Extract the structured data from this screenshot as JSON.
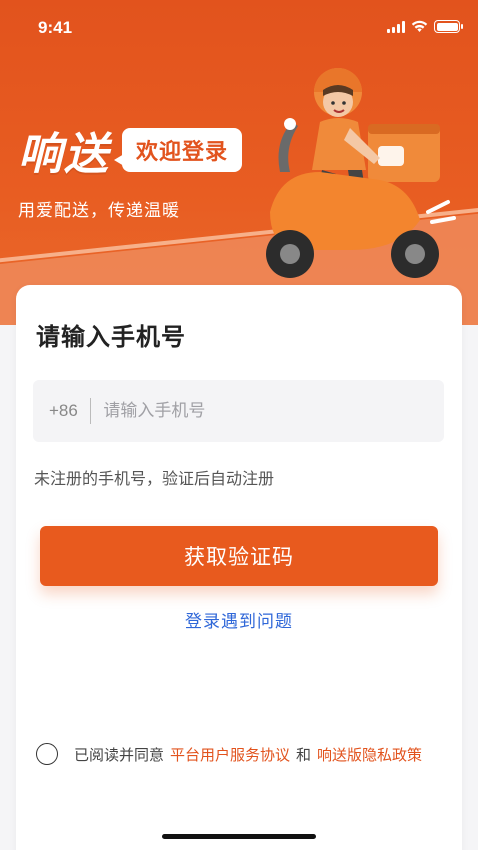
{
  "status_bar": {
    "time": "9:41"
  },
  "hero": {
    "brand_name": "响送",
    "welcome_badge": "欢迎登录",
    "slogan": "用爱配送，传递温暖"
  },
  "card": {
    "title": "请输入手机号",
    "country_code": "+86",
    "phone_placeholder": "请输入手机号",
    "phone_value": "",
    "hint": "未注册的手机号，验证后自动注册",
    "get_code_button": "获取验证码",
    "problem_link": "登录遇到问题"
  },
  "agreement": {
    "checked": false,
    "prefix": "已阅读并同意",
    "service_agreement": "平台用户服务协议",
    "conjunction": "和",
    "privacy_policy": "响送版隐私政策"
  },
  "colors": {
    "brand_orange": "#e85a1e",
    "link_blue": "#2f67d8"
  },
  "icons": [
    "signal-icon",
    "wifi-icon",
    "battery-icon",
    "delivery-rider-illustration"
  ]
}
